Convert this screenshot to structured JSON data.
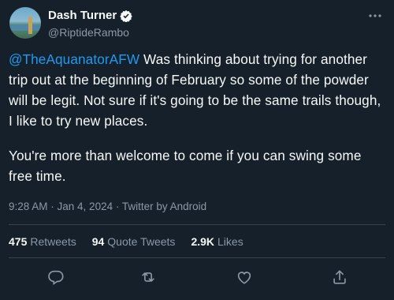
{
  "author": {
    "name": "Dash Turner",
    "handle": "@RiptideRambo"
  },
  "tweet": {
    "mention": "@TheAquanatorAFW",
    "line1_rest": " Was thinking about trying for another trip out at the beginning of February so some of the powder will be legit. Not sure if it's going to be the same trails though, I like to try new places.",
    "paragraph2": "You're more than welcome to come if you can swing some free time."
  },
  "meta": {
    "time": "9:28 AM",
    "date": "Jan 4, 2024",
    "source": "Twitter by Android",
    "separator": " · "
  },
  "stats": {
    "retweets_count": "475",
    "retweets_label": "Retweets",
    "quotes_count": "94",
    "quotes_label": "Quote Tweets",
    "likes_count": "2.9K",
    "likes_label": "Likes"
  },
  "colors": {
    "background": "#15202b",
    "accent": "#1d9bf0",
    "secondary_text": "#8b98a5",
    "divider": "#38444d"
  },
  "icons": [
    "verified-badge-icon",
    "more-icon",
    "reply-icon",
    "retweet-icon",
    "like-icon",
    "share-icon"
  ]
}
